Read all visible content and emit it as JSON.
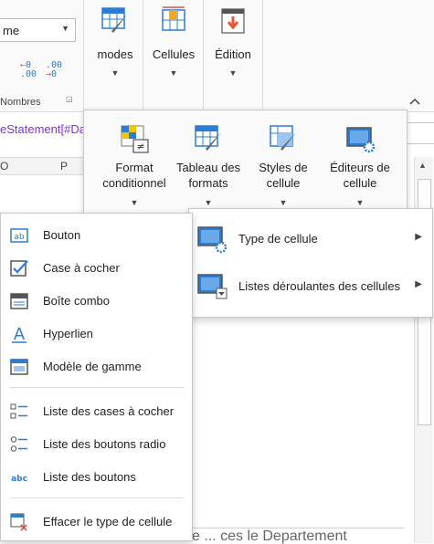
{
  "ribbon": {
    "format_value": "me",
    "nombres_label": "Nombres",
    "dec_increase": "←0\n.00",
    "dec_decrease": ".00\n→0",
    "modes_label": "modes",
    "cellules_label": "Cellules",
    "edition_label": "Édition",
    "collapse_glyph": "^"
  },
  "formula": {
    "text": "eStatement[#Da"
  },
  "columns": {
    "left": "O",
    "right": "P"
  },
  "panel": {
    "buttons": [
      {
        "line1": "Format",
        "line2": "conditionnel"
      },
      {
        "line1": "Tableau des",
        "line2": "formats"
      },
      {
        "line1": "Styles de",
        "line2": "cellule"
      },
      {
        "line1": "Éditeurs de",
        "line2": "cellule"
      }
    ]
  },
  "cell_types_menu": {
    "items": [
      {
        "label": "Bouton",
        "icon": "button-type-icon"
      },
      {
        "label": "Case à cocher",
        "icon": "checkbox-type-icon"
      },
      {
        "label": "Boîte combo",
        "icon": "combobox-type-icon"
      },
      {
        "label": "Hyperlien",
        "icon": "hyperlink-type-icon"
      },
      {
        "label": "Modèle de gamme",
        "icon": "range-template-icon"
      },
      {
        "label": "Liste des cases à cocher",
        "icon": "checkbox-list-icon"
      },
      {
        "label": "Liste des boutons radio",
        "icon": "radio-list-icon"
      },
      {
        "label": "Liste des boutons",
        "icon": "button-list-icon"
      },
      {
        "label": "Effacer le type de cellule",
        "icon": "clear-celltype-icon"
      }
    ]
  },
  "editors_submenu": {
    "items": [
      {
        "label": "Type de cellule"
      },
      {
        "label": "Listes déroulantes des cellules"
      }
    ]
  },
  "bottom_text": "e ... ces le Departement",
  "colors": {
    "accent": "#2b7cd3",
    "formula": "#8a2be2",
    "orange": "#f5a623"
  }
}
